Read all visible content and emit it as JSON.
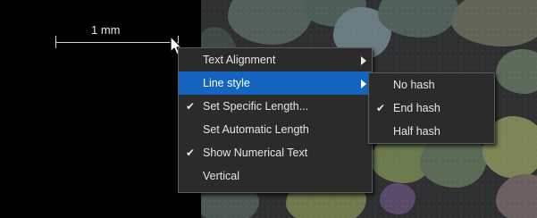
{
  "scalebar": {
    "label": "1 mm"
  },
  "context_menu": {
    "items": [
      {
        "label": "Text Alignment",
        "checked": false,
        "submenu": true,
        "highlighted": false
      },
      {
        "label": "Line style",
        "checked": false,
        "submenu": true,
        "highlighted": true
      },
      {
        "label": "Set Specific Length...",
        "checked": true,
        "submenu": false,
        "highlighted": false
      },
      {
        "label": "Set Automatic Length",
        "checked": false,
        "submenu": false,
        "highlighted": false
      },
      {
        "label": "Show Numerical Text",
        "checked": true,
        "submenu": false,
        "highlighted": false
      },
      {
        "label": "Vertical",
        "checked": false,
        "submenu": false,
        "highlighted": false
      }
    ],
    "check_glyph": "✔"
  },
  "line_style_submenu": {
    "items": [
      {
        "label": "No hash",
        "checked": false
      },
      {
        "label": "End hash",
        "checked": true
      },
      {
        "label": "Half hash",
        "checked": false
      }
    ]
  },
  "colors": {
    "menu_bg": "#2b2b2b",
    "menu_border": "#5b5b5b",
    "highlight": "#1565c0",
    "text": "#e6e6e6"
  },
  "icons": {
    "pointer": "arrow-cursor-icon",
    "check": "checkmark-icon",
    "submenu": "submenu-arrow-icon"
  }
}
